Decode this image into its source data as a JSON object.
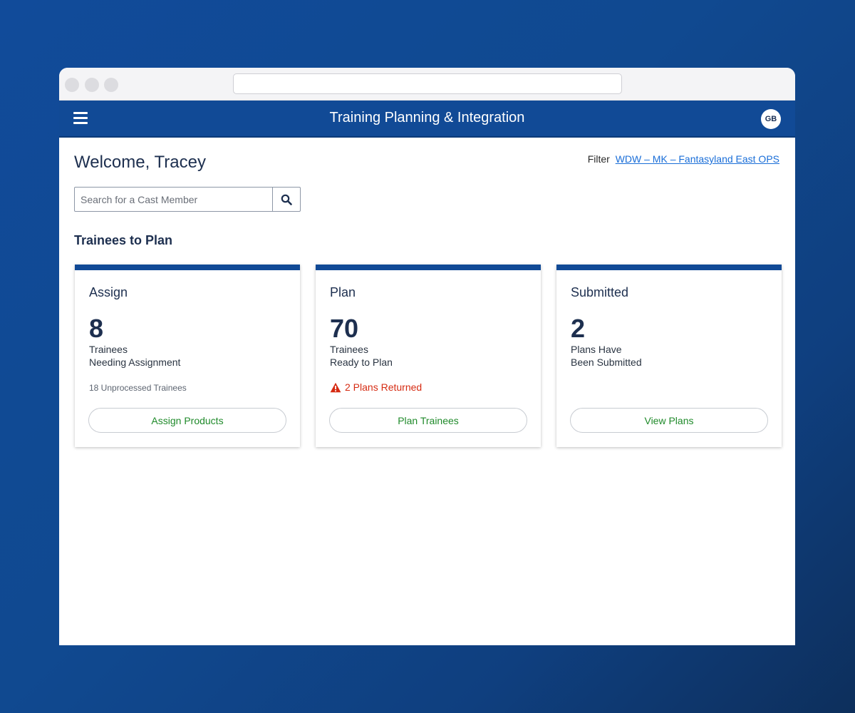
{
  "app": {
    "title": "Training Planning & Integration",
    "user_initials": "GB"
  },
  "welcome": {
    "greeting": "Welcome,",
    "name": "Tracey"
  },
  "filter": {
    "label": "Filter",
    "value": "WDW – MK – Fantasyland East OPS"
  },
  "search": {
    "placeholder": "Search for a Cast Member"
  },
  "section": {
    "title": "Trainees to Plan"
  },
  "cards": [
    {
      "title": "Assign",
      "count": "8",
      "line1": "Trainees",
      "line2": "Needing Assignment",
      "note": "18 Unprocessed Trainees",
      "button": "Assign Products"
    },
    {
      "title": "Plan",
      "count": "70",
      "line1": "Trainees",
      "line2": "Ready to Plan",
      "warning": "2 Plans Returned",
      "button": "Plan Trainees"
    },
    {
      "title": "Submitted",
      "count": "2",
      "line1": "Plans Have",
      "line2": "Been Submitted",
      "button": "View Plans"
    }
  ],
  "colors": {
    "brand": "#114a96",
    "button_text": "#1f8a2a",
    "warning": "#d62b12",
    "link": "#1a6ed8"
  },
  "icons": [
    "menu-icon",
    "search-icon",
    "warning-icon"
  ]
}
